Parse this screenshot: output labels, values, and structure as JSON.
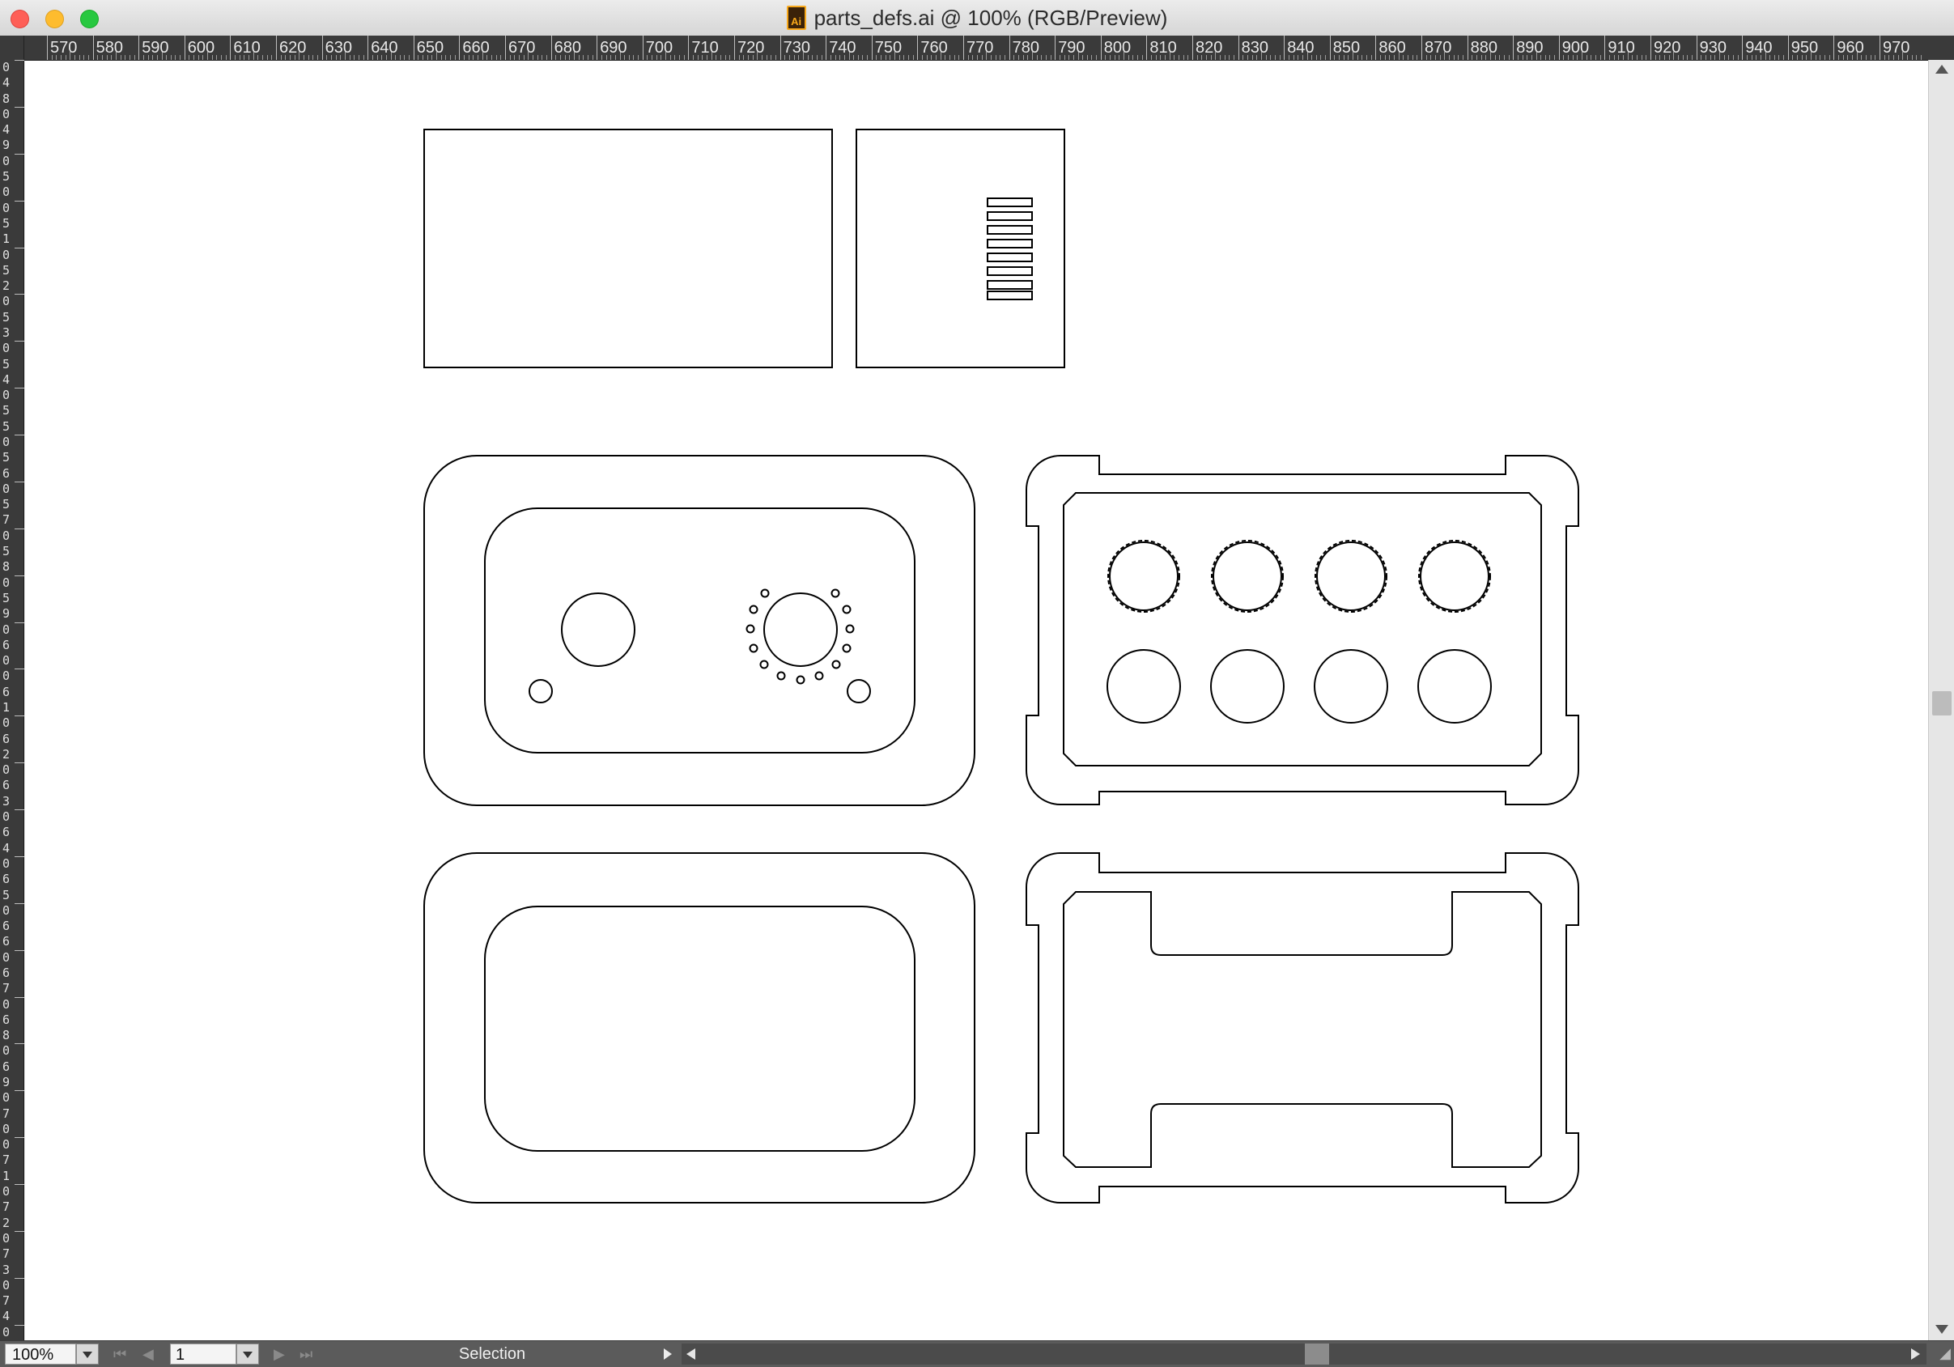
{
  "window": {
    "title": "parts_defs.ai @ 100% (RGB/Preview)",
    "app_icon_text": "Ai"
  },
  "ruler": {
    "horizontal_labels": [
      "570",
      "580",
      "590",
      "600",
      "610",
      "620",
      "630",
      "640",
      "650",
      "660",
      "670",
      "680",
      "690",
      "700",
      "710",
      "720",
      "730",
      "740",
      "750",
      "760",
      "770",
      "780",
      "790",
      "800",
      "810",
      "820",
      "830",
      "840",
      "850",
      "860",
      "870",
      "880",
      "890",
      "900",
      "910",
      "920",
      "930",
      "940",
      "950",
      "960",
      "970"
    ],
    "vertical_digits": [
      "0",
      "4",
      "8",
      "0",
      "4",
      "9",
      "0",
      "5",
      "0",
      "0",
      "5",
      "1",
      "0",
      "5",
      "2",
      "0",
      "5",
      "3",
      "0",
      "5",
      "4",
      "0",
      "5",
      "5",
      "0",
      "5",
      "6",
      "0",
      "5",
      "7",
      "0",
      "5",
      "8",
      "0",
      "5",
      "9",
      "0",
      "6",
      "0",
      "0",
      "6",
      "1",
      "0",
      "6",
      "2",
      "0",
      "6",
      "3",
      "0",
      "6",
      "4",
      "0",
      "6",
      "5",
      "0",
      "6",
      "6",
      "0",
      "6",
      "7",
      "0",
      "6",
      "8",
      "0",
      "6",
      "9",
      "0",
      "7",
      "0",
      "0",
      "7",
      "1",
      "0",
      "7",
      "2",
      "0",
      "7",
      "3",
      "0",
      "7",
      "4",
      "0"
    ]
  },
  "statusbar": {
    "zoom_value": "100%",
    "page_value": "1",
    "tool_label": "Selection"
  },
  "icons": {
    "first_page": "⏮",
    "prev_page": "◀",
    "next_page": "▶",
    "last_page": "⏭",
    "resize_grip": "◢"
  },
  "colors": {
    "close": "#fe5f57",
    "minimize": "#febc2e",
    "maximize": "#28c840",
    "ai_icon": "#f7a81b"
  }
}
